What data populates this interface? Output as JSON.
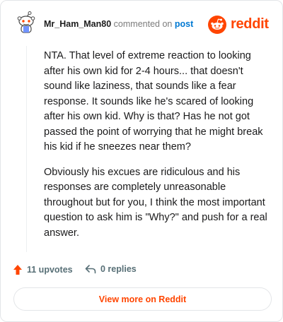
{
  "comment": {
    "username": "Mr_Ham_Man80",
    "meta_text": "commented on",
    "post_link_label": "post",
    "paragraphs": [
      "NTA. That level of extreme reaction to looking after his own kid for 2-4 hours... that doesn't sound like laziness, that sounds like a fear response. It sounds like he's scared of looking after his own kid. Why is that? Has he not got passed the point of worrying that he might break his kid if he sneezes near them?",
      "Obviously his excues are ridiculous and his responses are completely unreasonable throughout but for you, I think the most important question to ask him is \"Why?\" and push for a real answer."
    ]
  },
  "brand": {
    "wordmark": "reddit",
    "color": "#ff4500"
  },
  "actions": {
    "upvotes_label": "11 upvotes",
    "replies_label": "0 replies"
  },
  "footer": {
    "button_label": "View more on Reddit"
  },
  "icons": {
    "avatar": "snoo-avatar-icon",
    "brand": "reddit-logo-icon",
    "upvote": "upvote-arrow-icon",
    "reply": "reply-arrow-icon"
  }
}
